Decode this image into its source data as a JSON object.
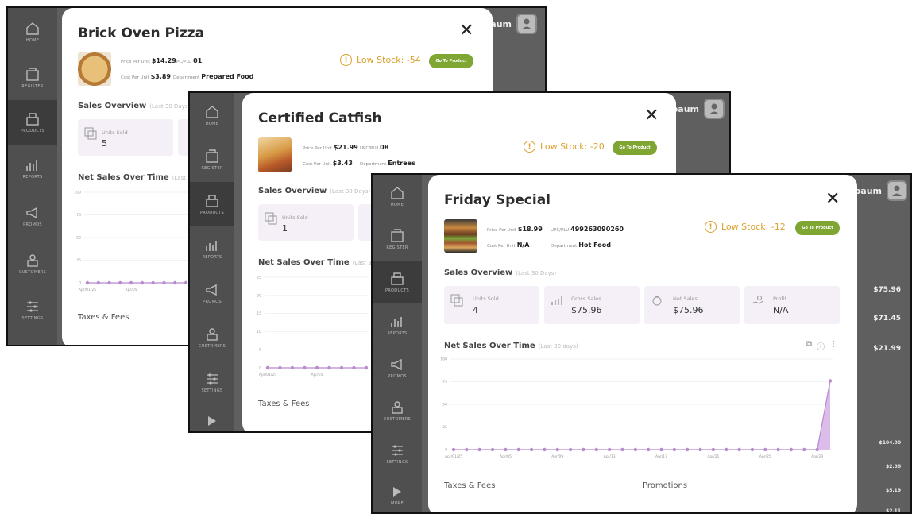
{
  "nav": {
    "labels": [
      "HOME",
      "REGISTER",
      "PRODUCTS",
      "REPORTS",
      "PROMOS",
      "CUSTOMERS",
      "SETTINGS",
      "MORE"
    ]
  },
  "bg": {
    "user_fragment": "lbaum",
    "user_fragment_3": "baum",
    "prices": [
      "$75.96",
      "$71.45",
      "$21.99"
    ],
    "list_prices": [
      "$104.00",
      "$2.08",
      "$5.19",
      "$2.11"
    ]
  },
  "modals": [
    {
      "title": "Brick Oven Pizza",
      "price_label": "Price Per Unit",
      "price": "$14.29",
      "upc_label": "UPC/PLU",
      "upc": "01",
      "cost_label": "Cost Per Unit",
      "cost": "$3.89",
      "dept_label": "Department",
      "dept": "Prepared Food",
      "low_stock": "Low Stock: -54",
      "go_btn": "Go To Product",
      "sales_overview": "Sales Overview",
      "range": "(Last 30 Days)",
      "units_label": "Units Sold",
      "units": "5",
      "net_sales_title": "Net Sales Over Time",
      "net_range": "(Last 30 days)",
      "taxes": "Taxes & Fees"
    },
    {
      "title": "Certified Catfish",
      "price_label": "Price Per Unit",
      "price": "$21.99",
      "upc_label": "UPC/PLU",
      "upc": "08",
      "cost_label": "Cost Per Unit",
      "cost": "$3.43",
      "dept_label": "Department",
      "dept": "Entrees",
      "low_stock": "Low Stock: -20",
      "go_btn": "Go To Product",
      "sales_overview": "Sales Overview",
      "range": "(Last 30 Days)",
      "units_label": "Units Sold",
      "units": "1",
      "net_sales_title": "Net Sales Over Time",
      "net_range": "(Last 30 days)",
      "taxes": "Taxes & Fees"
    },
    {
      "title": "Friday Special",
      "price_label": "Price Per Unit",
      "price": "$18.99",
      "upc_label": "UPC/PLU",
      "upc": "499263090260",
      "cost_label": "Cost Per Unit",
      "cost": "N/A",
      "dept_label": "Department",
      "dept": "Hot Food",
      "low_stock": "Low Stock: -12",
      "go_btn": "Go To Product",
      "sales_overview": "Sales Overview",
      "range": "(Last 30 Days)",
      "units_label": "Units Sold",
      "units": "4",
      "gross_label": "Gross Sales",
      "gross": "$75.96",
      "net_label": "Net Sales",
      "net": "$75.96",
      "profit_label": "Profit",
      "profit": "N/A",
      "net_sales_title": "Net Sales Over Time",
      "net_range": "(Last 30 days)",
      "taxes": "Taxes & Fees",
      "promotions": "Promotions"
    }
  ],
  "chart_data": [
    {
      "type": "line",
      "title": "Net Sales Over Time",
      "y_ticks": [
        "100",
        "75",
        "50",
        "25",
        "0"
      ],
      "x_ticks": [
        "Apr/01/25",
        "Apr/05"
      ],
      "ylim": [
        0,
        100
      ],
      "values": [
        0,
        0,
        0,
        0,
        0,
        0,
        0,
        0,
        0,
        0
      ]
    },
    {
      "type": "line",
      "title": "Net Sales Over Time",
      "y_ticks": [
        "25",
        "20",
        "15",
        "10",
        "5",
        "0"
      ],
      "x_ticks": [
        "Apr/01/25",
        "Apr/05"
      ],
      "ylim": [
        0,
        25
      ],
      "values": [
        0,
        0,
        0,
        0,
        0,
        0,
        0,
        0,
        0
      ]
    },
    {
      "type": "area",
      "title": "Net Sales Over Time",
      "y_ticks": [
        "100",
        "75",
        "50",
        "25",
        "0"
      ],
      "x_ticks": [
        "Apr/01/25",
        "Apr/05",
        "Apr/09",
        "Apr/13",
        "Apr/17",
        "Apr/21",
        "Apr/25",
        "Apr/29"
      ],
      "ylim": [
        0,
        100
      ],
      "values": [
        0,
        0,
        0,
        0,
        0,
        0,
        0,
        0,
        0,
        0,
        0,
        0,
        0,
        0,
        0,
        0,
        0,
        0,
        0,
        0,
        0,
        0,
        0,
        0,
        0,
        0,
        0,
        0,
        0,
        75.96
      ]
    }
  ]
}
